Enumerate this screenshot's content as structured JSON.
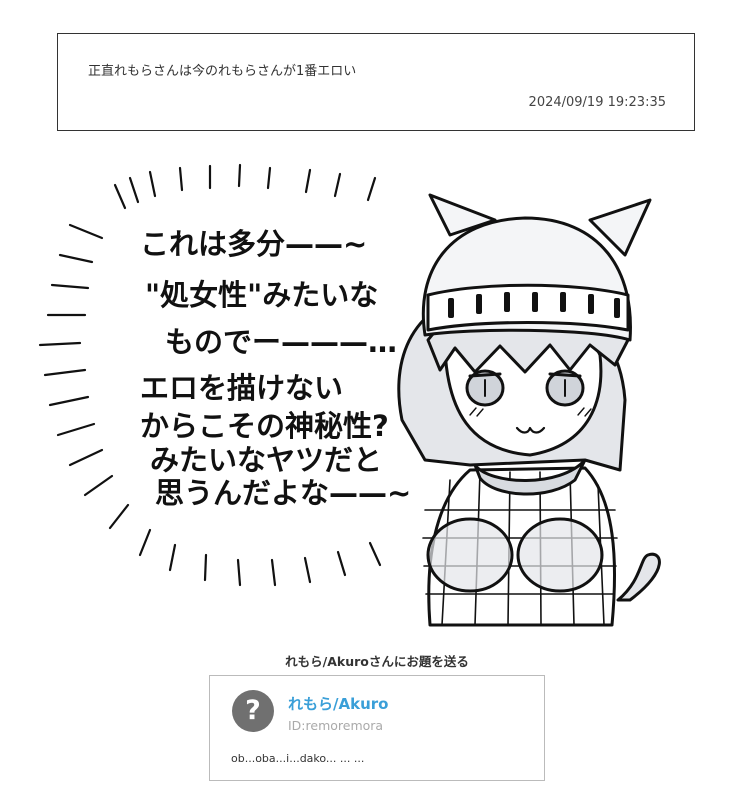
{
  "question": {
    "text": "正直れもらさんは今のれもらさんが1番エロい",
    "timestamp": "2024/09/19 19:23:35"
  },
  "illustration": {
    "lines": [
      "これは多分——~",
      "\"処女性\"みたいな",
      "ものでー———…",
      "エロを描けない",
      "からこその神秘性?",
      "みたいなヤツだと",
      "思うんだよな——~"
    ]
  },
  "send_section": {
    "heading": "れもら/Akuroさんにお題を送る",
    "profile": {
      "avatar_symbol": "?",
      "name": "れもら/Akuro",
      "id": "ID:remoremora",
      "bio": "ob...oba...i...dako... ... ..."
    }
  },
  "colors": {
    "accent": "#3a9fd8",
    "avatar_bg": "#707070",
    "border": "#333333",
    "card_border": "#bbbbbb"
  }
}
